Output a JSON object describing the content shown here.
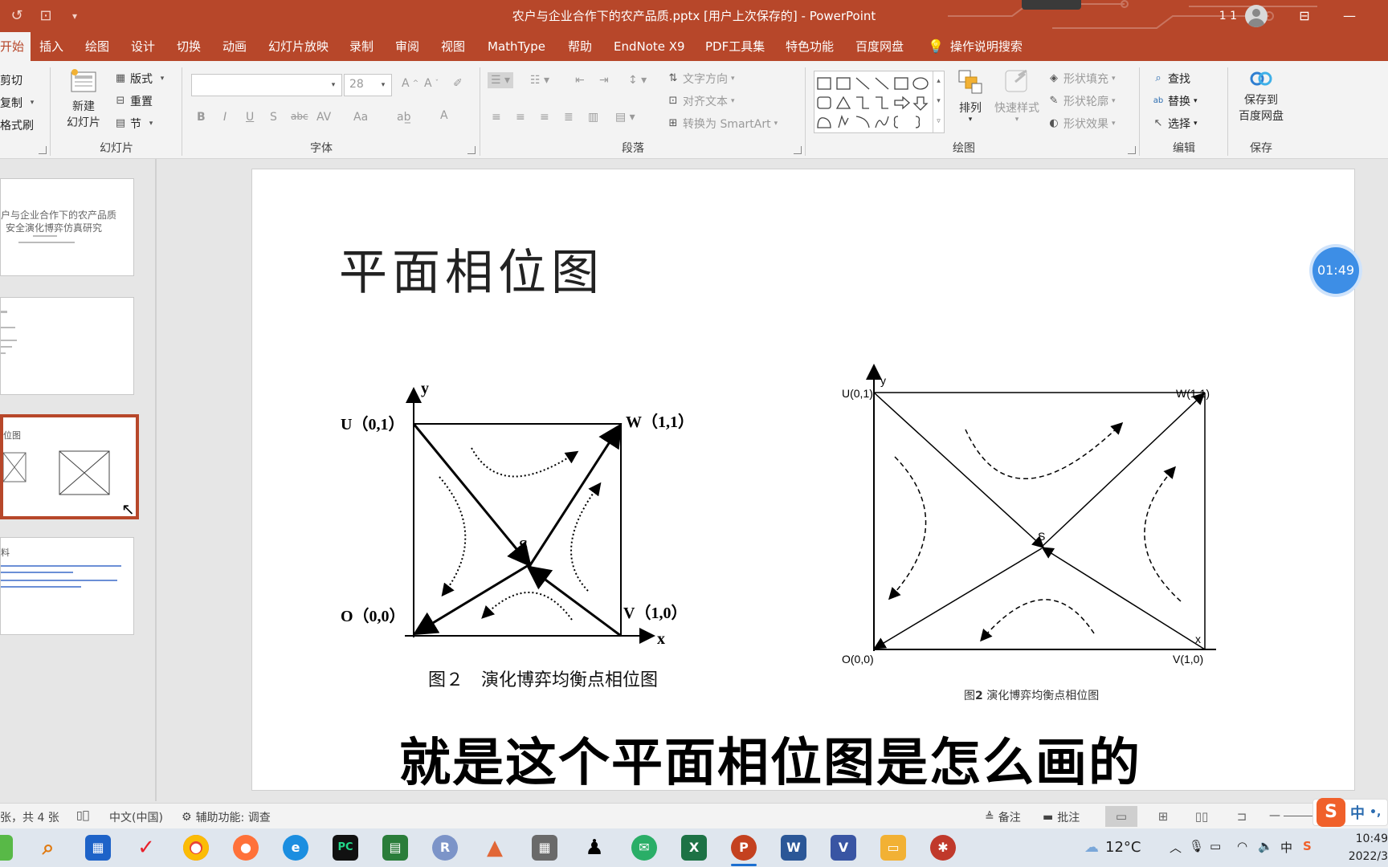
{
  "window": {
    "title": "农户与企业合作下的农产品质.pptx [用户上次保存的]  -  PowerPoint",
    "user_initials": "1 1"
  },
  "tabs": [
    "开始",
    "插入",
    "绘图",
    "设计",
    "切换",
    "动画",
    "幻灯片放映",
    "录制",
    "审阅",
    "视图",
    "MathType",
    "帮助",
    "EndNote X9",
    "PDF工具集",
    "特色功能",
    "百度网盘"
  ],
  "tell_me": "操作说明搜索",
  "ribbon": {
    "clipboard": {
      "cut": "剪切",
      "copy": "复制",
      "format_painter": "格式刷"
    },
    "slides": {
      "new_slide_line1": "新建",
      "new_slide_line2": "幻灯片",
      "layout": "版式",
      "reset": "重置",
      "section": "节",
      "label": "幻灯片"
    },
    "font": {
      "size": "28",
      "label": "字体",
      "bold": "B",
      "italic": "I",
      "underline": "U",
      "shadow": "S",
      "strike": "abc",
      "spacing": "AV",
      "case": "Aa"
    },
    "paragraph": {
      "text_direction": "文字方向",
      "align_text": "对齐文本",
      "smartart": "转换为 SmartArt",
      "label": "段落"
    },
    "drawing": {
      "arrange": "排列",
      "quick_styles": "快速样式",
      "shape_fill": "形状填充",
      "shape_outline": "形状轮廓",
      "shape_effects": "形状效果",
      "label": "绘图"
    },
    "editing": {
      "find": "查找",
      "replace": "替换",
      "select": "选择",
      "label": "编辑"
    },
    "save": {
      "line1": "保存到",
      "line2": "百度网盘",
      "label": "保存"
    }
  },
  "thumbnails": {
    "slide1_line1": "户与企业合作下的农产品质",
    "slide1_line2": "安全演化博弈仿真研究",
    "slide3_title": "位图",
    "slide4_title": "料"
  },
  "slide": {
    "title": "平面相位图",
    "caption": "就是这个平面相位图是怎么画的",
    "left_figure": {
      "y": "y",
      "x": "x",
      "U": "U（0,1）",
      "W": "W（1,1）",
      "O": "O（0,0）",
      "V": "V（1,0）",
      "S": "S",
      "caption": "图２　演化博弈均衡点相位图"
    },
    "right_figure": {
      "y": "y",
      "x": "x",
      "U": "U(0,1)",
      "W": "W(1,1)",
      "O": "O(0,0)",
      "V": "V(1,0)",
      "S": "S",
      "caption_prefix": "图",
      "caption_num": "2",
      "caption_rest": " 演化博弈均衡点相位图"
    }
  },
  "timer": "01:49",
  "statusbar": {
    "slide_info": "张，共 4 张",
    "language": "中文(中国)",
    "accessibility": "辅助功能: 调查",
    "notes": "备注",
    "comments": "批注"
  },
  "taskbar": {
    "weather": "12°C",
    "time": "10:49",
    "date": "2022/3",
    "ime": "中"
  }
}
